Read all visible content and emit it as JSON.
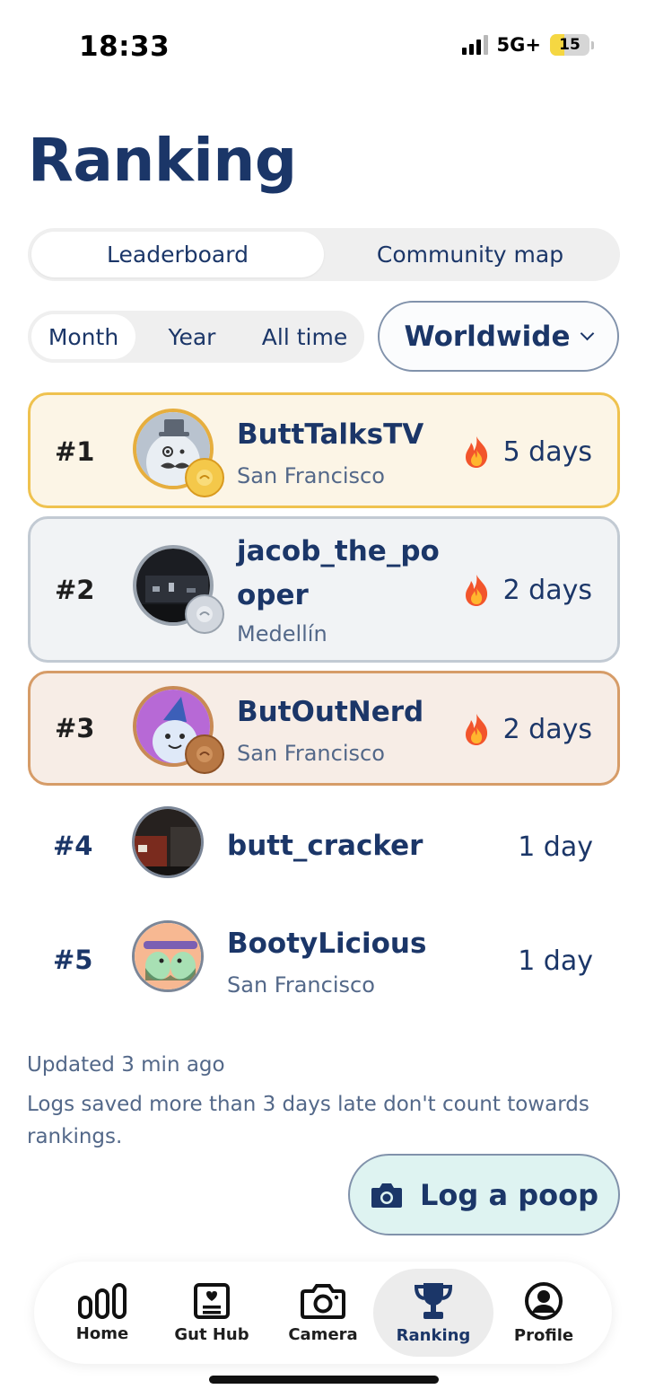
{
  "status_bar": {
    "time": "18:33",
    "network": "5G+",
    "battery": "15",
    "battery_level": 0.15
  },
  "title": "Ranking",
  "main_tabs": [
    {
      "label": "Leaderboard",
      "active": true
    },
    {
      "label": "Community map",
      "active": false
    }
  ],
  "period_tabs": [
    {
      "label": "Month",
      "active": true
    },
    {
      "label": "Year",
      "active": false
    },
    {
      "label": "All time",
      "active": false
    }
  ],
  "region": {
    "label": "Worldwide"
  },
  "leaderboard": [
    {
      "rank": "#1",
      "name": "ButtTalksTV",
      "city": "San Francisco",
      "streak": "5 days",
      "medal": "gold",
      "fire": true
    },
    {
      "rank": "#2",
      "name_line1": "jacob_the_po",
      "name_line2": "oper",
      "city": "Medellín",
      "streak": "2 days",
      "medal": "silver",
      "fire": true
    },
    {
      "rank": "#3",
      "name": "ButOutNerd",
      "city": "San Francisco",
      "streak": "2 days",
      "medal": "bronze",
      "fire": true
    },
    {
      "rank": "#4",
      "name": "butt_cracker",
      "city": "",
      "streak": "1 day",
      "fire": false
    },
    {
      "rank": "#5",
      "name": "BootyLicious",
      "city": "San Francisco",
      "streak": "1 day",
      "fire": false
    }
  ],
  "footer": {
    "updated": "Updated 3 min ago",
    "note_line1": "Logs saved more than 3 days late don't count towards",
    "note_line2": "rankings."
  },
  "log_button": {
    "label": "Log a poop",
    "icon": "camera-icon"
  },
  "tab_bar": [
    {
      "label": "Home",
      "icon": "home-chart-icon"
    },
    {
      "label": "Gut Hub",
      "icon": "gut-hub-icon"
    },
    {
      "label": "Camera",
      "icon": "camera-icon"
    },
    {
      "label": "Ranking",
      "icon": "trophy-icon",
      "active": true
    },
    {
      "label": "Profile",
      "icon": "profile-icon"
    }
  ],
  "colors": {
    "navy": "#1b3668",
    "gold_bg": "#fcf5e6",
    "gold_border": "#efc24f",
    "silver_bg": "#f1f3f5",
    "silver_border": "#c2cad3",
    "bronze_bg": "#f7ede6",
    "bronze_border": "#d69c68",
    "log_button_bg": "#def3f1"
  }
}
